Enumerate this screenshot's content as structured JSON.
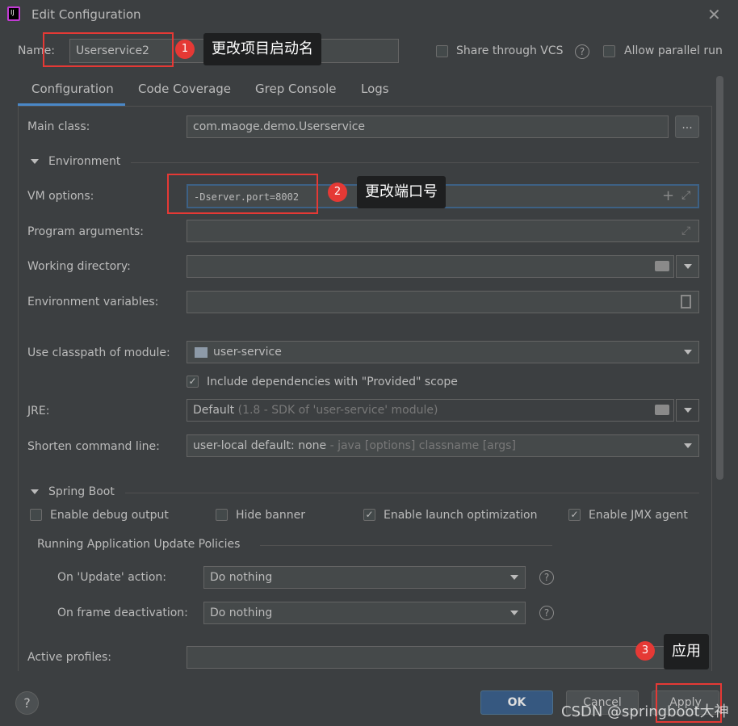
{
  "window": {
    "title": "Edit Configuration"
  },
  "name_row": {
    "label": "Name:",
    "value": "Userservice2",
    "share_vcs": "Share through VCS",
    "allow_parallel": "Allow parallel run"
  },
  "tabs": [
    {
      "label": "Configuration",
      "active": true
    },
    {
      "label": "Code Coverage"
    },
    {
      "label": "Grep Console"
    },
    {
      "label": "Logs"
    }
  ],
  "form": {
    "main_class_label": "Main class:",
    "main_class": "com.maoge.demo.Userservice",
    "browse": "...",
    "environment": "Environment",
    "vm_label": "VM options:",
    "vm_value": "-Dserver.port=8002",
    "program_args_label": "Program arguments:",
    "working_dir_label": "Working directory:",
    "env_vars_label": "Environment variables:",
    "classpath_label": "Use classpath of module:",
    "classpath_value": "user-service",
    "include_deps": "Include dependencies with \"Provided\" scope",
    "include_deps_checked": true,
    "jre_label": "JRE:",
    "jre_value": "Default",
    "jre_hint": "(1.8 - SDK of 'user-service' module)",
    "shorten_label": "Shorten command line:",
    "shorten_value": "user-local default: none",
    "shorten_hint": "- java [options] classname [args]",
    "spring_boot": "Spring Boot",
    "enable_debug": "Enable debug output",
    "enable_debug_checked": false,
    "hide_banner": "Hide banner",
    "hide_banner_checked": false,
    "launch_opt": "Enable launch optimization",
    "launch_opt_checked": true,
    "jmx": "Enable JMX agent",
    "jmx_checked": true,
    "policies": "Running Application Update Policies",
    "on_update_label": "On 'Update' action:",
    "on_update_value": "Do nothing",
    "on_frame_label": "On frame deactivation:",
    "on_frame_value": "Do nothing",
    "active_profiles_label": "Active profiles:"
  },
  "buttons": {
    "ok": "OK",
    "cancel": "Cancel",
    "apply": "Apply",
    "help": "?"
  },
  "annotations": [
    {
      "num": "1",
      "text": "更改项目启动名"
    },
    {
      "num": "2",
      "text": "更改端口号"
    },
    {
      "num": "3",
      "text": "应用"
    }
  ],
  "watermark": "CSDN @springboot大神",
  "colors": {
    "accent": "#4a88c7",
    "ok_button": "#365880",
    "annotation": "#e53935"
  }
}
